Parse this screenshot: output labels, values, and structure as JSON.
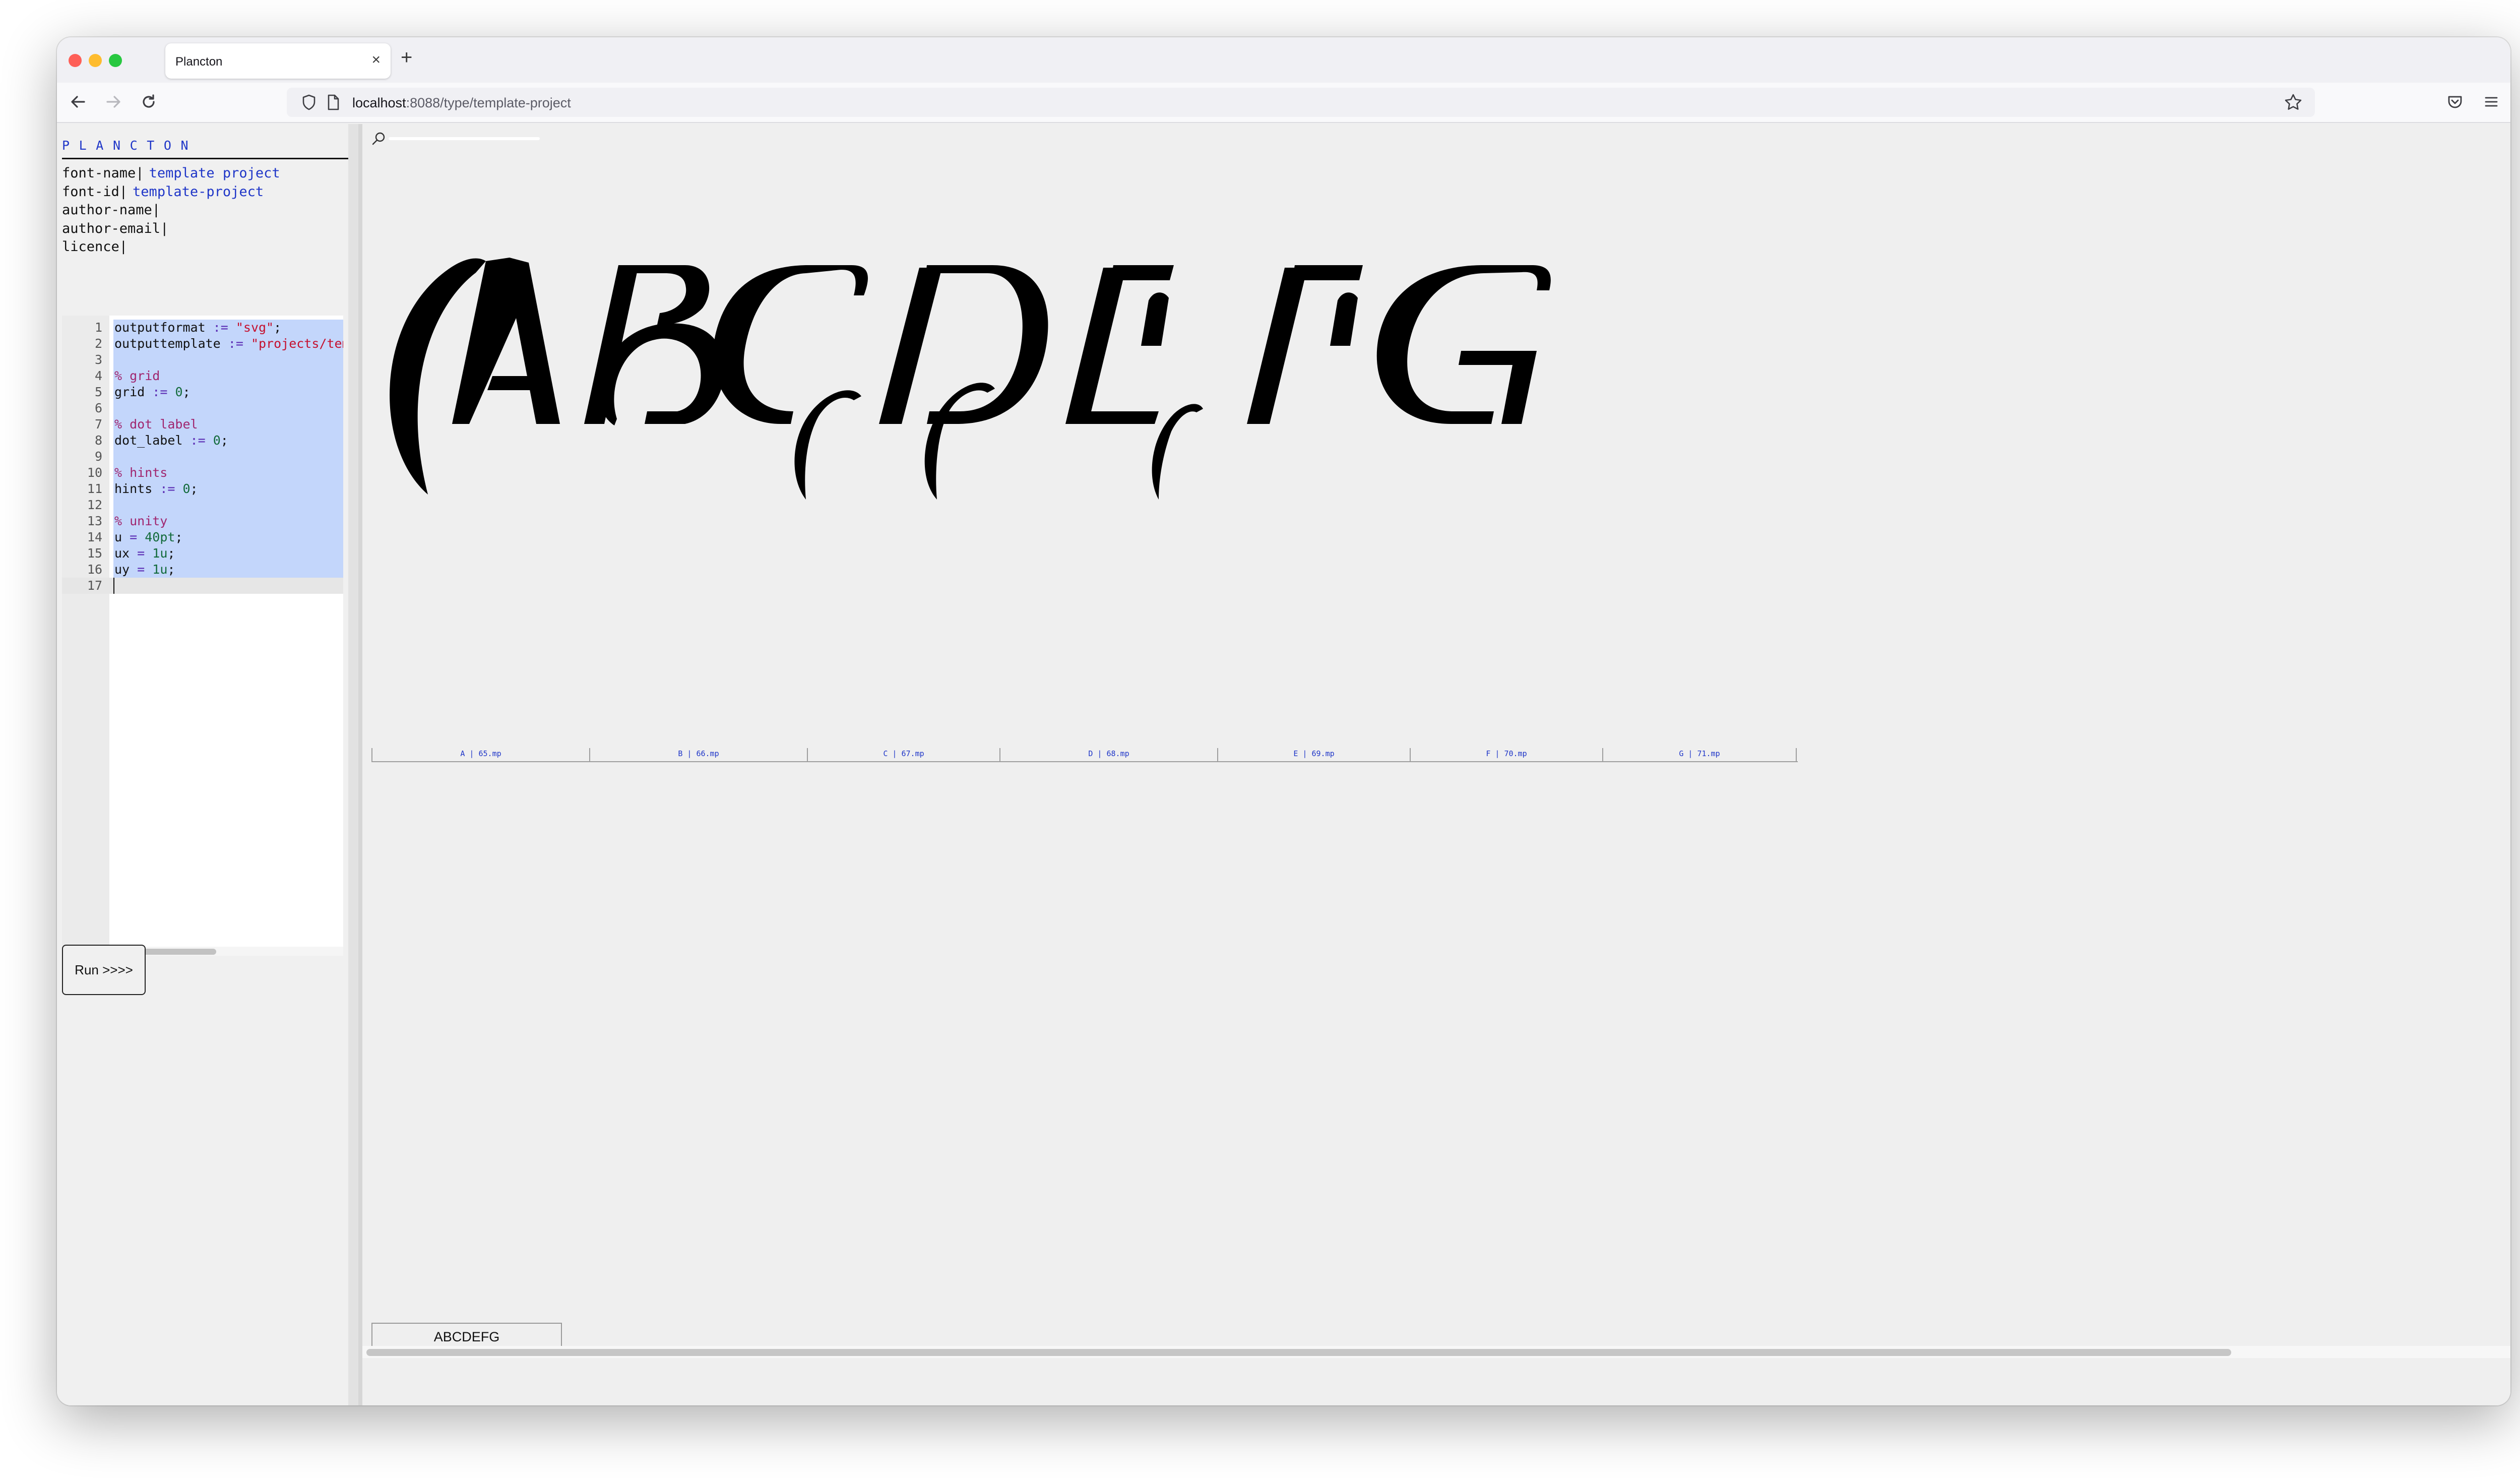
{
  "browser": {
    "tab_title": "Plancton",
    "tab_close": "×",
    "new_tab": "+",
    "url_host": "localhost",
    "url_path": ":8088/type/template-project"
  },
  "sidebar": {
    "brand": "PLANCTON",
    "meta": [
      {
        "key": "font-name|",
        "value": "template project"
      },
      {
        "key": "font-id|",
        "value": "template-project"
      },
      {
        "key": "author-name|",
        "value": ""
      },
      {
        "key": "author-email|",
        "value": ""
      },
      {
        "key": "licence|",
        "value": ""
      }
    ],
    "run_label": "Run >>>>"
  },
  "editor": {
    "lines": [
      {
        "n": "1",
        "segs": [
          [
            "outputformat ",
            ""
          ],
          [
            ":=",
            "op"
          ],
          [
            " ",
            ""
          ],
          [
            "\"svg\"",
            "string"
          ],
          [
            ";",
            ""
          ]
        ]
      },
      {
        "n": "2",
        "segs": [
          [
            "outputtemplate ",
            ""
          ],
          [
            ":=",
            "op"
          ],
          [
            " ",
            ""
          ],
          [
            "\"projects/template-project/",
            "string"
          ]
        ]
      },
      {
        "n": "3",
        "segs": []
      },
      {
        "n": "4",
        "segs": [
          [
            "% grid",
            "comment"
          ]
        ]
      },
      {
        "n": "5",
        "segs": [
          [
            "grid ",
            ""
          ],
          [
            ":=",
            "op"
          ],
          [
            " ",
            ""
          ],
          [
            "0",
            "number"
          ],
          [
            ";",
            ""
          ]
        ]
      },
      {
        "n": "6",
        "segs": []
      },
      {
        "n": "7",
        "segs": [
          [
            "% dot label",
            "comment"
          ]
        ]
      },
      {
        "n": "8",
        "segs": [
          [
            "dot_label ",
            ""
          ],
          [
            ":=",
            "op"
          ],
          [
            " ",
            ""
          ],
          [
            "0",
            "number"
          ],
          [
            ";",
            ""
          ]
        ]
      },
      {
        "n": "9",
        "segs": []
      },
      {
        "n": "10",
        "segs": [
          [
            "% hints",
            "comment"
          ]
        ]
      },
      {
        "n": "11",
        "segs": [
          [
            "hints ",
            ""
          ],
          [
            ":=",
            "op"
          ],
          [
            " ",
            ""
          ],
          [
            "0",
            "number"
          ],
          [
            ";",
            ""
          ]
        ]
      },
      {
        "n": "12",
        "segs": []
      },
      {
        "n": "13",
        "segs": [
          [
            "% unity",
            "comment"
          ]
        ]
      },
      {
        "n": "14",
        "segs": [
          [
            "u ",
            ""
          ],
          [
            "=",
            "op"
          ],
          [
            " ",
            ""
          ],
          [
            "40pt",
            "number"
          ],
          [
            ";",
            ""
          ]
        ]
      },
      {
        "n": "15",
        "segs": [
          [
            "ux ",
            ""
          ],
          [
            "=",
            "op"
          ],
          [
            " ",
            ""
          ],
          [
            "1u",
            "number"
          ],
          [
            ";",
            ""
          ]
        ]
      },
      {
        "n": "16",
        "segs": [
          [
            "uy ",
            ""
          ],
          [
            "=",
            "op"
          ],
          [
            " ",
            ""
          ],
          [
            "1u",
            "number"
          ],
          [
            ";",
            ""
          ]
        ]
      },
      {
        "n": "17",
        "segs": []
      }
    ]
  },
  "canvas": {
    "glyphs": [
      "A",
      "B",
      "C",
      "D",
      "E",
      "F",
      "G"
    ],
    "glyph_labels": [
      "A | 65.mp",
      "B | 66.mp",
      "C | 67.mp",
      "D | 68.mp",
      "E | 69.mp",
      "F | 70.mp",
      "G | 71.mp"
    ],
    "preview_text": "ABCDEFG"
  },
  "colors": {
    "accent": "#1f36c8",
    "selection": "#c3d6fb",
    "glyph_fill": "#000000"
  },
  "icons": [
    "back-arrow-icon",
    "forward-arrow-icon",
    "reload-icon",
    "shield-icon",
    "page-icon",
    "bookmark-star-icon",
    "pocket-icon",
    "menu-icon",
    "zoom-icon"
  ]
}
